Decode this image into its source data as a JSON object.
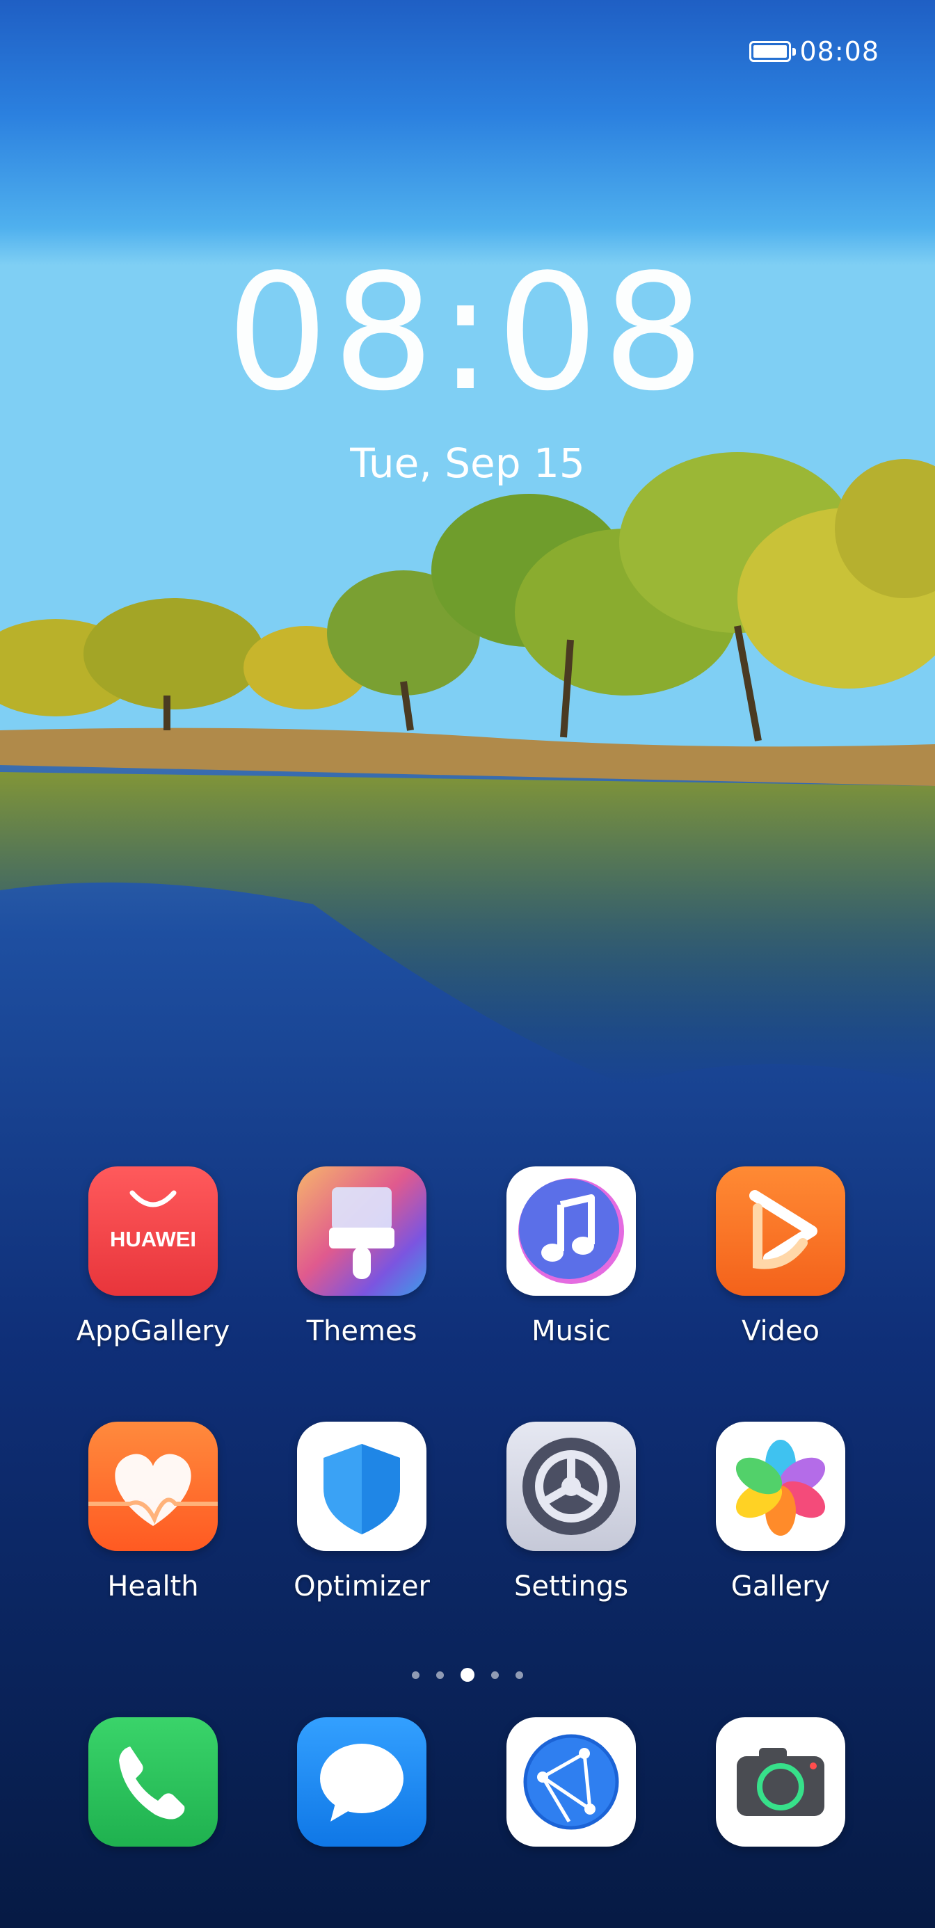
{
  "status_bar": {
    "time": "08:08",
    "battery_level": 1.0
  },
  "lock_clock": {
    "time": "08:08",
    "date": "Tue, Sep 15"
  },
  "apps_row1": [
    {
      "label": "AppGallery",
      "icon": "appgallery-icon",
      "brand_text": "HUAWEI"
    },
    {
      "label": "Themes",
      "icon": "themes-icon"
    },
    {
      "label": "Music",
      "icon": "music-icon"
    },
    {
      "label": "Video",
      "icon": "video-icon"
    }
  ],
  "apps_row2": [
    {
      "label": "Health",
      "icon": "health-icon"
    },
    {
      "label": "Optimizer",
      "icon": "optimizer-icon"
    },
    {
      "label": "Settings",
      "icon": "settings-icon"
    },
    {
      "label": "Gallery",
      "icon": "gallery-icon"
    }
  ],
  "page_indicator": {
    "pages": 5,
    "current": 3
  },
  "dock": [
    {
      "icon": "phone-icon"
    },
    {
      "icon": "messages-icon"
    },
    {
      "icon": "browser-icon"
    },
    {
      "icon": "camera-icon"
    }
  ],
  "colors": {
    "appgallery": "#ef3f43",
    "video": "#fa7a21",
    "health": "#ff6a2b",
    "phone": "#2fc25b",
    "messages": "#1e88f2",
    "optimizer": "#2c8cf0"
  }
}
